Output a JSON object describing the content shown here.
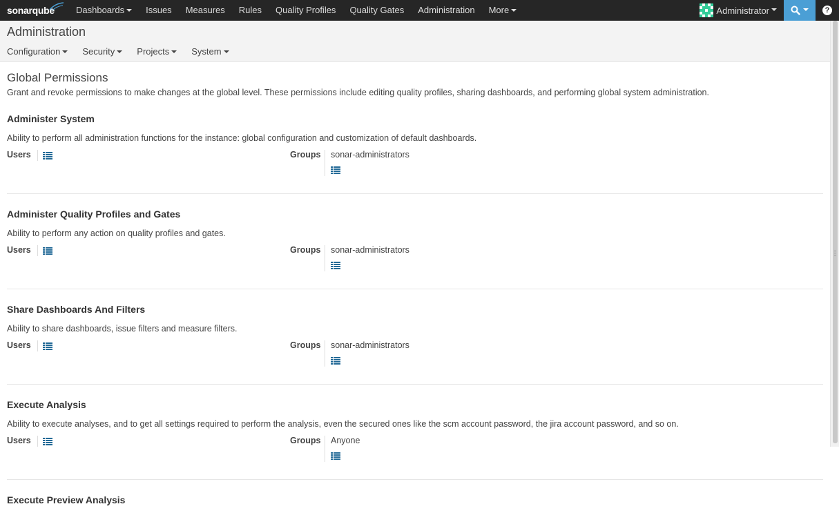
{
  "navbar": {
    "logo_text": "sonarqube",
    "items": [
      {
        "label": "Dashboards",
        "dropdown": true
      },
      {
        "label": "Issues",
        "dropdown": false
      },
      {
        "label": "Measures",
        "dropdown": false
      },
      {
        "label": "Rules",
        "dropdown": false
      },
      {
        "label": "Quality Profiles",
        "dropdown": false
      },
      {
        "label": "Quality Gates",
        "dropdown": false
      },
      {
        "label": "Administration",
        "dropdown": false
      },
      {
        "label": "More",
        "dropdown": true
      }
    ],
    "user": "Administrator",
    "search_icon": "search-icon",
    "help_icon": "help-icon",
    "colors": {
      "bar": "#262626",
      "accent": "#4b9fd5"
    }
  },
  "page": {
    "title": "Administration",
    "sub_nav": [
      "Configuration",
      "Security",
      "Projects",
      "System"
    ]
  },
  "section": {
    "title": "Global Permissions",
    "description": "Grant and revoke permissions to make changes at the global level. These permissions include editing quality profiles, sharing dashboards, and performing global system administration."
  },
  "labels": {
    "users": "Users",
    "groups": "Groups"
  },
  "permissions": [
    {
      "name": "Administer System",
      "description": "Ability to perform all administration functions for the instance: global configuration and customization of default dashboards.",
      "groups": "sonar-administrators"
    },
    {
      "name": "Administer Quality Profiles and Gates",
      "description": "Ability to perform any action on quality profiles and gates.",
      "groups": "sonar-administrators"
    },
    {
      "name": "Share Dashboards And Filters",
      "description": "Ability to share dashboards, issue filters and measure filters.",
      "groups": "sonar-administrators"
    },
    {
      "name": "Execute Analysis",
      "description": "Ability to execute analyses, and to get all settings required to perform the analysis, even the secured ones like the scm account password, the jira account password, and so on.",
      "groups": "Anyone"
    },
    {
      "name": "Execute Preview Analysis"
    }
  ]
}
